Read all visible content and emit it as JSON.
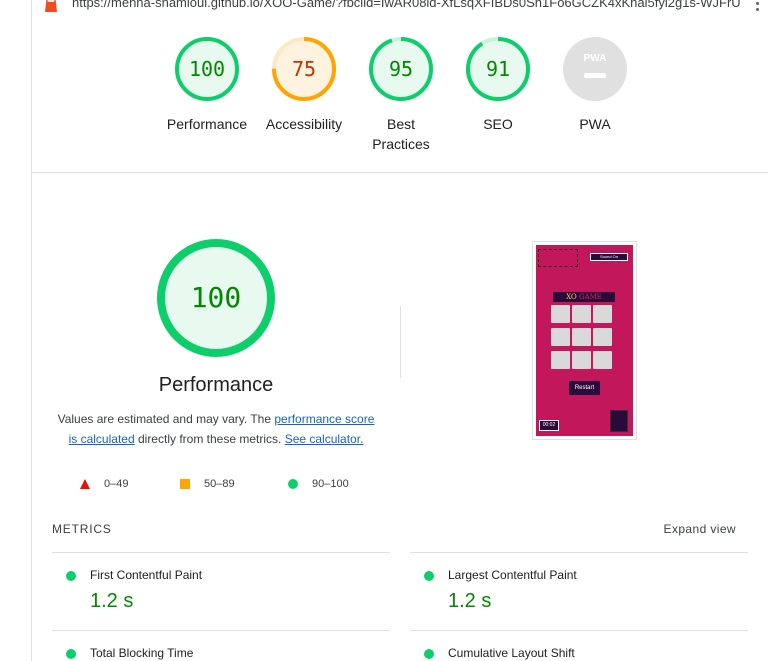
{
  "browser": {
    "url": "https://menna-shamloul.github.io/XOO-Game/?fbclid=IwAR08ld-XfLsqXFIBDs0Sh1Fo6GCZK4xKhal5fyl2g1s-WJFrU1jXIK..."
  },
  "category_scores": [
    {
      "label": "Performance",
      "score": "100",
      "value": 100,
      "status": "pass"
    },
    {
      "label": "Accessibility",
      "score": "75",
      "value": 75,
      "status": "average"
    },
    {
      "label": "Best Practices",
      "score": "95",
      "value": 95,
      "status": "pass"
    },
    {
      "label": "SEO",
      "score": "91",
      "value": 91,
      "status": "pass"
    },
    {
      "label": "PWA",
      "score": "PWA",
      "value": null,
      "status": "na"
    }
  ],
  "performance_summary": {
    "score": "100",
    "title": "Performance",
    "desc_prefix": "Values are estimated and may vary. The ",
    "desc_link1": "performance score is calculated",
    "desc_middle": " directly from these metrics. ",
    "desc_link2": "See calculator."
  },
  "legend": [
    {
      "icon": "triangle",
      "range": "0–49",
      "color": "#eb0f00"
    },
    {
      "icon": "square",
      "range": "50–89",
      "color": "#ffa400"
    },
    {
      "icon": "circle",
      "range": "90–100",
      "color": "#0cce6b"
    }
  ],
  "screenshot": {
    "top_button": "Sound On",
    "title_x": "XO",
    "title_rest": "GAME",
    "restart": "Restart",
    "timer": "00:02"
  },
  "metrics": {
    "heading": "METRICS",
    "expand_label": "Expand view",
    "items": [
      {
        "label": "First Contentful Paint",
        "value": "1.2 s"
      },
      {
        "label": "Largest Contentful Paint",
        "value": "1.2 s"
      },
      {
        "label": "Total Blocking Time",
        "value": ""
      },
      {
        "label": "Cumulative Layout Shift",
        "value": ""
      }
    ]
  },
  "colors": {
    "pass": "#0cce6b",
    "pass_text": "#008800",
    "average": "#ffa400",
    "average_text": "#c33300",
    "na": "#e0e0e0"
  }
}
